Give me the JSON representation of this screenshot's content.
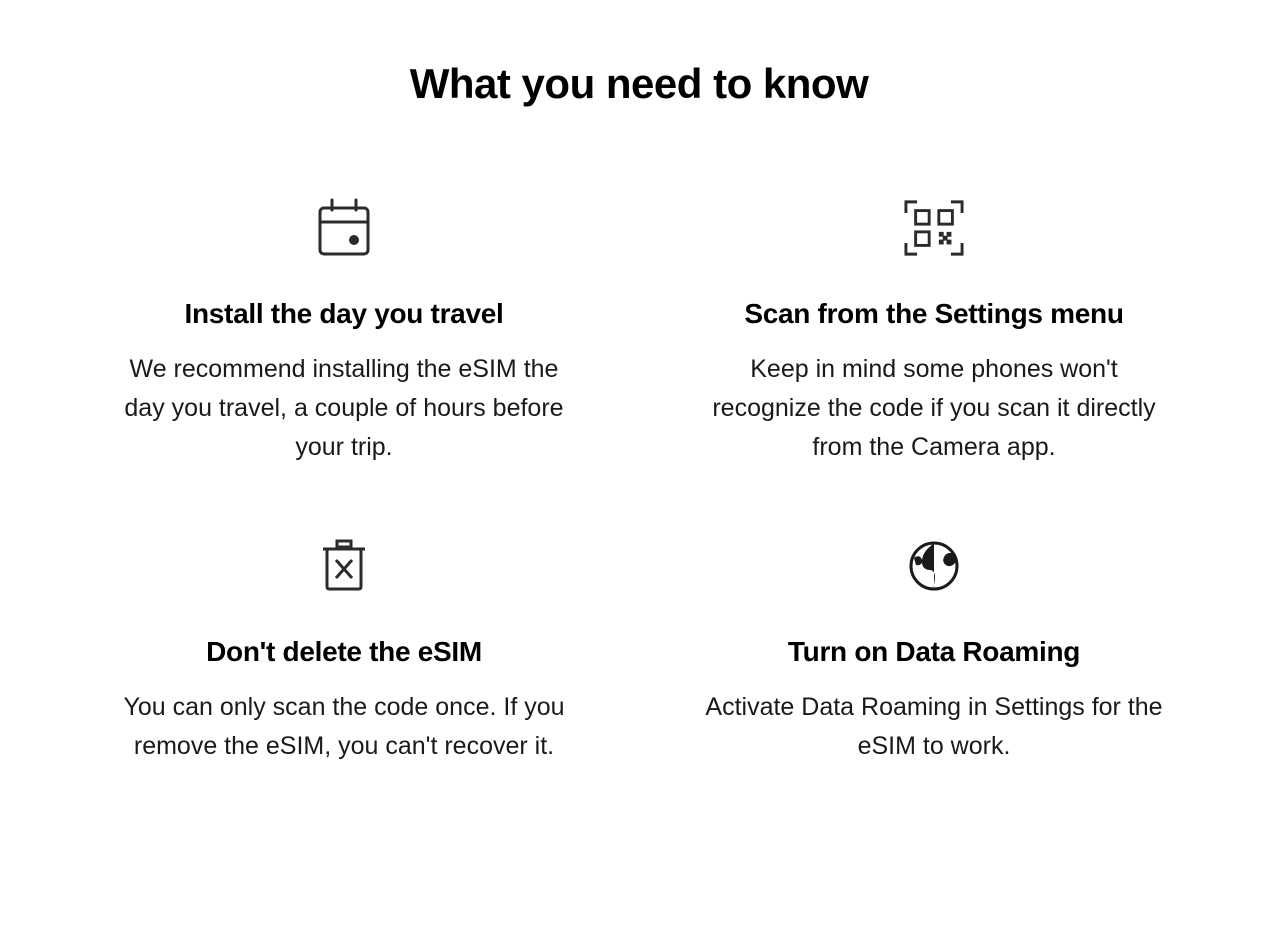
{
  "title": "What you need to know",
  "cards": [
    {
      "heading": "Install the day you travel",
      "body": "We recommend installing the eSIM the day you travel, a couple of hours before your trip."
    },
    {
      "heading": "Scan from the Settings menu",
      "body": "Keep in mind some phones won't recognize the code if you scan it directly from the Camera app."
    },
    {
      "heading": "Don't delete the eSIM",
      "body": "You can only scan the code once. If you remove the eSIM, you can't recover it."
    },
    {
      "heading": "Turn on Data Roaming",
      "body": "Activate Data Roaming in Settings for the eSIM to work."
    }
  ]
}
